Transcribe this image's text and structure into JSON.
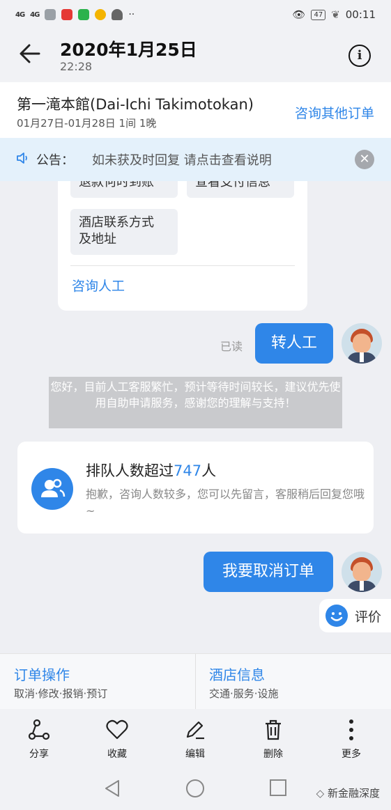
{
  "status_bar": {
    "signal_1": "4G",
    "signal_2": "4G",
    "more": "··",
    "battery": "47",
    "time": "00:11"
  },
  "header": {
    "title": "2020年1月25日",
    "time": "22:28"
  },
  "hotel": {
    "name": "第一滝本館(Dai-Ichi Takimotokan)",
    "dates": "01月27日-01月28日 1间 1晚",
    "other_orders_link": "咨询其他订单"
  },
  "notice": {
    "label": "公告：",
    "text": "如未获及时回复 请点击查看说明"
  },
  "menu_card": {
    "top_left": "退款何时到账",
    "top_right": "查看支付信息",
    "contact_button": "酒店联系方式\n及地址",
    "human_link": "咨询人工"
  },
  "messages": {
    "read_status": "已读",
    "user_message_1": "转人工",
    "system_notice": "您好，目前人工客服繁忙，预计等待时间较长，建议优先使用自助申请服务，感谢您的理解与支持！",
    "queue_title_prefix": "排队人数超过",
    "queue_count": "747",
    "queue_title_suffix": "人",
    "queue_desc": "抱歉，咨询人数较多，您可以先留言，客服稍后回复您哦~",
    "user_message_2": "我要取消订单",
    "rate_label": "评价"
  },
  "actions": [
    {
      "title": "订单操作",
      "subtitle": "取消·修改·报销·预订"
    },
    {
      "title": "酒店信息",
      "subtitle": "交通·服务·设施"
    }
  ],
  "toolbar": [
    {
      "label": "分享",
      "icon": "share-icon"
    },
    {
      "label": "收藏",
      "icon": "heart-icon"
    },
    {
      "label": "编辑",
      "icon": "pen-icon"
    },
    {
      "label": "删除",
      "icon": "trash-icon"
    },
    {
      "label": "更多",
      "icon": "more-vertical-icon"
    }
  ],
  "watermark": "新金融深度",
  "colors": {
    "accent": "#2f86e8",
    "background": "#eeeff3",
    "notice_bg": "#e4f1fb",
    "system_bubble": "#c9cacd"
  }
}
